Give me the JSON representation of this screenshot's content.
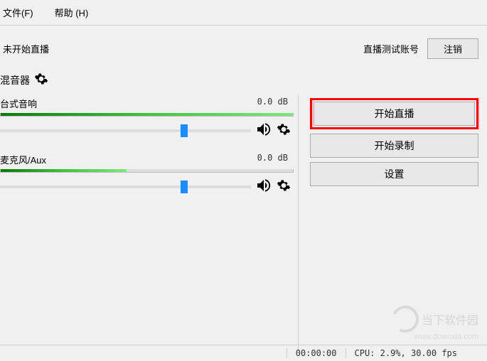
{
  "menubar": {
    "file": "文件(F)",
    "help": "帮助 (H)"
  },
  "status": {
    "not_started": "未开始直播",
    "account": "直播测试账号",
    "logout": "注销"
  },
  "mixer": {
    "header": "混音器",
    "items": [
      {
        "name": "台式音响",
        "db": "0.0 dB",
        "level_pct": 100,
        "slider_pct": 72
      },
      {
        "name": "麦克风/Aux",
        "db": "0.0 dB",
        "level_pct": 43,
        "slider_pct": 72
      }
    ]
  },
  "buttons": {
    "start_stream": "开始直播",
    "start_record": "开始录制",
    "settings": "设置"
  },
  "statusbar": {
    "time": "00:00:00",
    "cpu": "CPU: 2.9%, 30.00 fps"
  },
  "watermark": {
    "text": "当下软件园",
    "url": "www.downxia.com"
  }
}
